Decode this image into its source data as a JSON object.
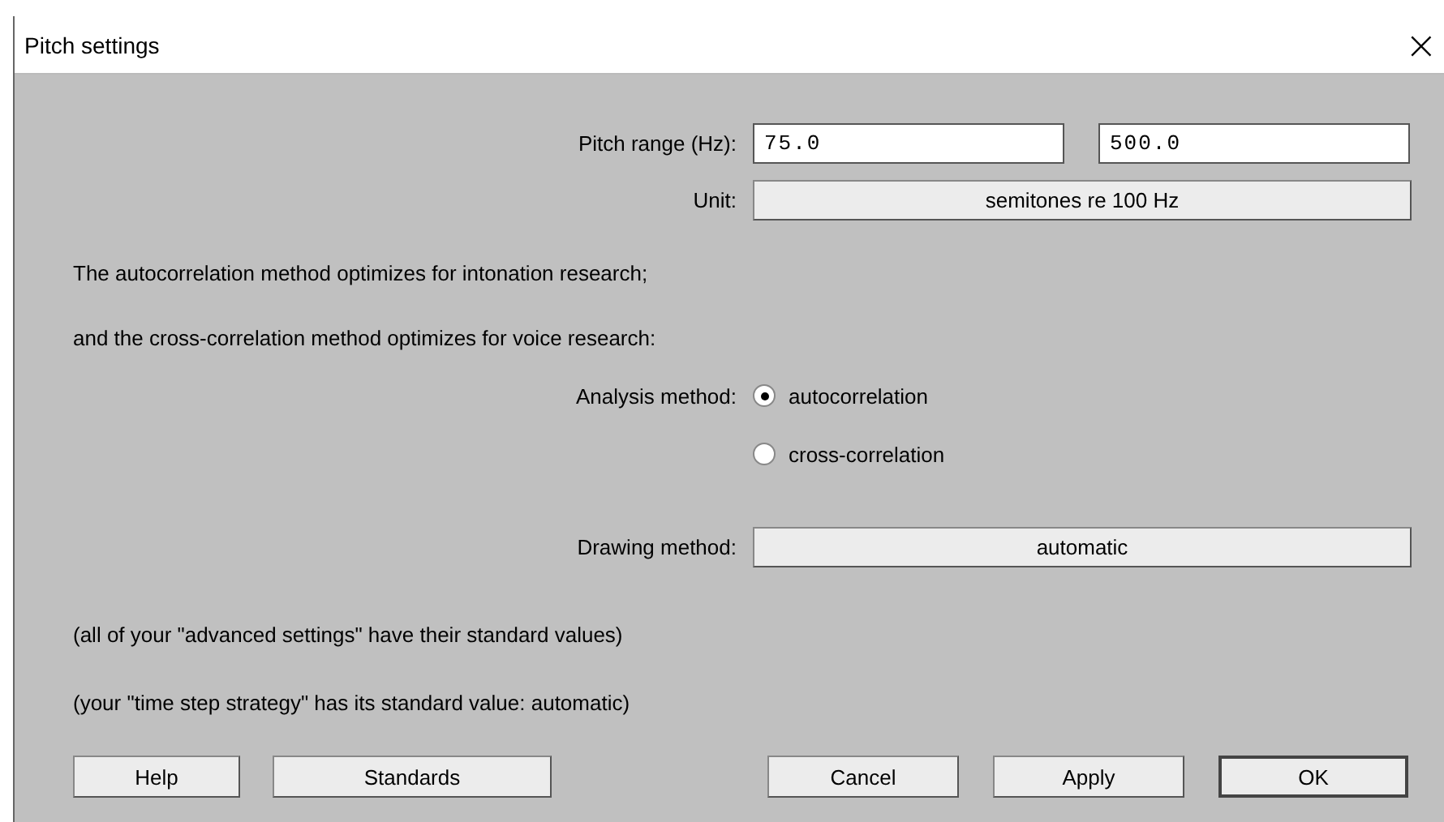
{
  "window": {
    "title": "Pitch settings",
    "close": "×"
  },
  "pitch_range": {
    "label": "Pitch range (Hz):",
    "from": "75.0",
    "to": "500.0"
  },
  "unit": {
    "label": "Unit:",
    "value": "semitones re 100 Hz"
  },
  "notes": [
    "The autocorrelation method optimizes for intonation research;",
    "and the cross-correlation method optimizes for voice research:"
  ],
  "analysis_method": {
    "label": "Analysis method:",
    "options": [
      {
        "label": "autocorrelation",
        "selected": true
      },
      {
        "label": "cross-correlation",
        "selected": false
      }
    ]
  },
  "drawing_method": {
    "label": "Drawing method:",
    "value": "automatic"
  },
  "info": [
    "(all of your \"advanced settings\" have their standard values)",
    "(your \"time step strategy\" has its standard value: automatic)"
  ],
  "buttons_left": [
    "Help",
    "Standards"
  ],
  "buttons_right": [
    {
      "label": "Cancel",
      "default": false
    },
    {
      "label": "Apply",
      "default": false
    },
    {
      "label": "OK",
      "default": true
    }
  ]
}
